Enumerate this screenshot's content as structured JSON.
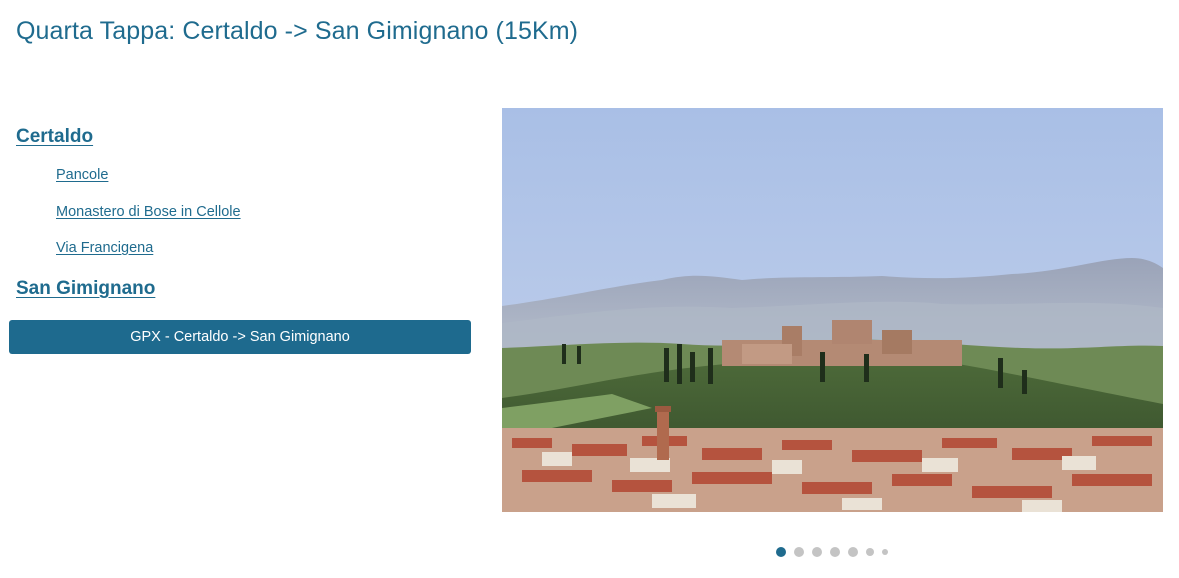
{
  "page": {
    "title": "Quarta Tappa: Certaldo -> San Gimignano (15Km)"
  },
  "itinerary": {
    "start": "Certaldo",
    "waypoints": [
      {
        "label": "Pancole"
      },
      {
        "label": "Monastero di Bose in Cellole"
      },
      {
        "label": "Via Francigena"
      }
    ],
    "end": "San Gimignano",
    "gpx_button_label": "GPX - Certaldo -> San Gimignano"
  },
  "carousel": {
    "slide_count": 7,
    "active_index": 0
  },
  "colors": {
    "accent": "#1f6b8e",
    "button_bg": "#1e6a8e",
    "dot_inactive": "#c4c4c4"
  }
}
